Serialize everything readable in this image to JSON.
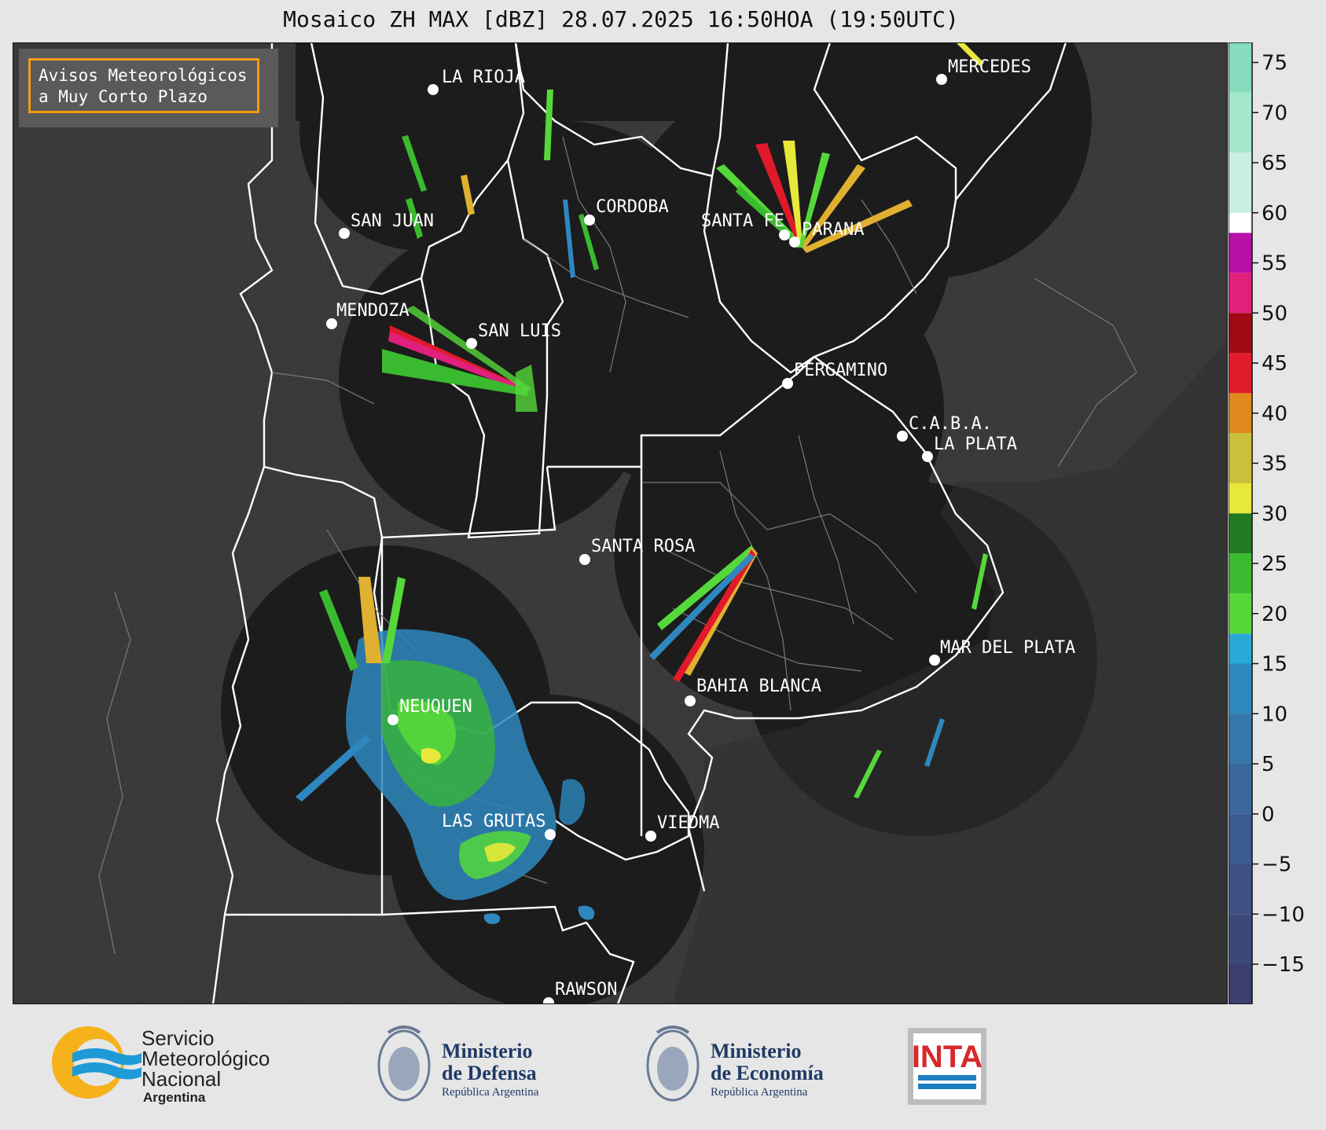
{
  "title": "Mosaico ZH MAX [dBZ] 28.07.2025 16:50HOA (19:50UTC)",
  "notice": {
    "line1": "Avisos Meteorológicos",
    "line2": "a Muy Corto Plazo"
  },
  "cities": [
    {
      "id": "la-rioja",
      "name": "LA RIOJA"
    },
    {
      "id": "mercedes",
      "name": "MERCEDES"
    },
    {
      "id": "san-juan",
      "name": "SAN JUAN"
    },
    {
      "id": "cordoba",
      "name": "CORDOBA"
    },
    {
      "id": "santa-fe",
      "name": "SANTA FE"
    },
    {
      "id": "parana",
      "name": "PARANA"
    },
    {
      "id": "mendoza",
      "name": "MENDOZA"
    },
    {
      "id": "san-luis",
      "name": "SAN LUIS"
    },
    {
      "id": "pergamino",
      "name": "PERGAMINO"
    },
    {
      "id": "caba",
      "name": "C.A.B.A."
    },
    {
      "id": "la-plata",
      "name": "LA PLATA"
    },
    {
      "id": "santa-rosa",
      "name": "SANTA ROSA"
    },
    {
      "id": "mar-del-plata",
      "name": "MAR DEL PLATA"
    },
    {
      "id": "bahia-blanca",
      "name": "BAHIA BLANCA"
    },
    {
      "id": "neuquen",
      "name": "NEUQUEN"
    },
    {
      "id": "las-grutas",
      "name": "LAS GRUTAS"
    },
    {
      "id": "viedma",
      "name": "VIEDMA"
    },
    {
      "id": "rawson",
      "name": "RAWSON"
    }
  ],
  "colorbar": {
    "unit": "dBZ",
    "min": -19,
    "max": 77,
    "ticks": [
      "75",
      "70",
      "65",
      "60",
      "55",
      "50",
      "45",
      "40",
      "35",
      "30",
      "25",
      "20",
      "15",
      "10",
      "5",
      "0",
      "−5",
      "−10",
      "−15"
    ],
    "tick_values": [
      75,
      70,
      65,
      60,
      55,
      50,
      45,
      40,
      35,
      30,
      25,
      20,
      15,
      10,
      5,
      0,
      -5,
      -10,
      -15
    ],
    "bands": [
      {
        "from": -19,
        "to": -15,
        "color": "#3a3f6e"
      },
      {
        "from": -15,
        "to": -10,
        "color": "#3c477a"
      },
      {
        "from": -10,
        "to": -5,
        "color": "#3d5185"
      },
      {
        "from": -5,
        "to": 0,
        "color": "#3c5c90"
      },
      {
        "from": 0,
        "to": 5,
        "color": "#3a689c"
      },
      {
        "from": 5,
        "to": 10,
        "color": "#3676aa"
      },
      {
        "from": 10,
        "to": 15,
        "color": "#2e88bf"
      },
      {
        "from": 15,
        "to": 18,
        "color": "#28a9d8"
      },
      {
        "from": 18,
        "to": 22,
        "color": "#55d83a"
      },
      {
        "from": 22,
        "to": 26,
        "color": "#3aba2e"
      },
      {
        "from": 26,
        "to": 30,
        "color": "#227a22"
      },
      {
        "from": 30,
        "to": 33,
        "color": "#e8e83a"
      },
      {
        "from": 33,
        "to": 38,
        "color": "#ccc03a"
      },
      {
        "from": 38,
        "to": 42,
        "color": "#e08a1e"
      },
      {
        "from": 42,
        "to": 46,
        "color": "#e01a2a"
      },
      {
        "from": 46,
        "to": 50,
        "color": "#a00a12"
      },
      {
        "from": 50,
        "to": 54,
        "color": "#e0207a"
      },
      {
        "from": 54,
        "to": 58,
        "color": "#b810a8"
      },
      {
        "from": 58,
        "to": 60,
        "color": "#ffffff"
      },
      {
        "from": 60,
        "to": 66,
        "color": "#c8f0e0"
      },
      {
        "from": 66,
        "to": 72,
        "color": "#a4e8cc"
      },
      {
        "from": 72,
        "to": 77,
        "color": "#86dcbc"
      }
    ]
  },
  "logos": {
    "smn": {
      "line1": "Servicio",
      "line2": "Meteorológico",
      "line3": "Nacional",
      "line4": "Argentina"
    },
    "defensa": {
      "line1": "Ministerio",
      "line2": "de Defensa",
      "line3": "República Argentina"
    },
    "economia": {
      "line1": "Ministerio",
      "line2": "de Economía",
      "line3": "República Argentina"
    },
    "inta": {
      "text": "INTA"
    }
  },
  "colors": {
    "background": "#e6e6e6",
    "map": "#3a3a3a",
    "radar": "#1b1b1b",
    "accent": "#f29a14"
  }
}
